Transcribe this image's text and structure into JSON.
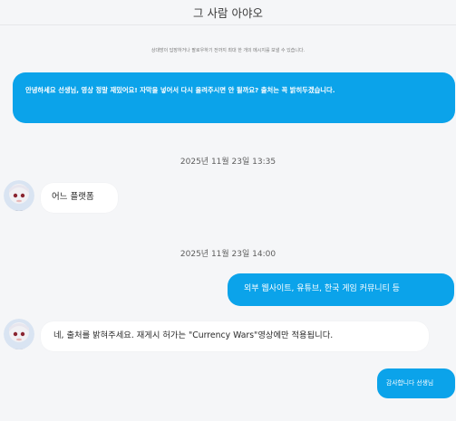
{
  "header": {
    "title": "그 사람 아야오"
  },
  "notice": "상대방이 답장하거나 팔로우하기 전까지 최대 한 개의 메시지를 보낼 수 있습니다.",
  "colors": {
    "accent": "#0ba3ea",
    "background": "#f5f6f8",
    "bubble_other": "#ffffff"
  },
  "messages": [
    {
      "sender": "me",
      "text": "안녕하세요 선생님, 영상 정말 재밌어요! 자막을 넣어서 다시 올려주시면 안 될까요? 출처는 꼭 밝히두겠습니다."
    },
    {
      "type": "timestamp",
      "text": "2025년 11월 23일 13:35"
    },
    {
      "sender": "other",
      "avatar_icon": "avatar-icon",
      "text": "어느 플랫폼"
    },
    {
      "type": "timestamp",
      "text": "2025년 11월 23일 14:00"
    },
    {
      "sender": "me",
      "text": "외부 웹사이트, 유튜브, 한국 게임 커뮤니티 등"
    },
    {
      "sender": "other",
      "avatar_icon": "avatar-icon",
      "text": "네, 출처를 밝혀주세요. 재게시 허가는 \"Currency Wars\"영상에만 적용됩니다."
    },
    {
      "sender": "me",
      "text": "감사합니다 선생님"
    }
  ]
}
